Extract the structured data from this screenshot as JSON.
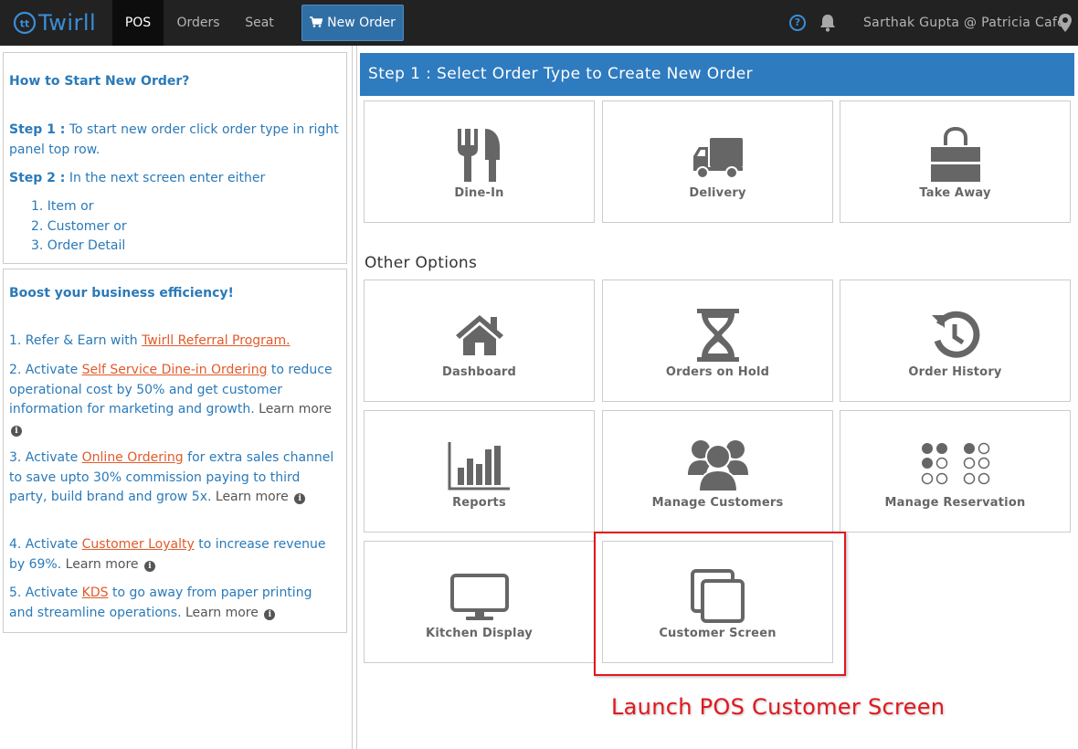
{
  "app": {
    "logo_text": "Twirll",
    "brand_color": "#3b8ed6"
  },
  "nav": {
    "pos": "POS",
    "orders": "Orders",
    "seat": "Seat",
    "new_order": "New Order",
    "user": "Sarthak Gupta @ Patricia Cafe"
  },
  "help_panel": {
    "title": "How to Start New Order?",
    "step1_label": "Step 1 :",
    "step1_text": "To start new order click order type in right panel top row.",
    "step2_label": "Step 2 :",
    "step2_text": "In the next screen enter either",
    "items": [
      "1. Item or",
      "2. Customer or",
      "3. Order Detail"
    ]
  },
  "boost_panel": {
    "title": "Boost your business efficiency!",
    "item1_pre": "1. Refer & Earn with",
    "item1_link": "Twirll Referral Program.",
    "item2_pre": "2. Activate",
    "item2_link": "Self Service Dine-in Ordering",
    "item2_post": "to reduce operational cost by 50% and get customer information for marketing and growth.",
    "item3_pre": "3. Activate",
    "item3_link": "Online Ordering",
    "item3_post": "for extra sales channel to save upto 30% commission paying to third party, build brand and grow 5x.",
    "item4_pre": "4. Activate",
    "item4_link": "Customer Loyalty",
    "item4_post": "to increase revenue by 69%.",
    "item5_pre": "5. Activate",
    "item5_link": "KDS",
    "item5_post": "to go away from paper printing and streamline operations.",
    "learn_more": "Learn more"
  },
  "main": {
    "step_header": "Step 1 : Select Order Type to Create New Order",
    "order_types": [
      "Dine-In",
      "Delivery",
      "Take Away"
    ],
    "other_options_title": "Other Options",
    "options": [
      "Dashboard",
      "Orders on Hold",
      "Order History",
      "Reports",
      "Manage Customers",
      "Manage Reservation",
      "Kitchen Display",
      "Customer Screen"
    ]
  },
  "annotation": {
    "text": "Launch POS Customer Screen",
    "color": "#e0181e"
  }
}
